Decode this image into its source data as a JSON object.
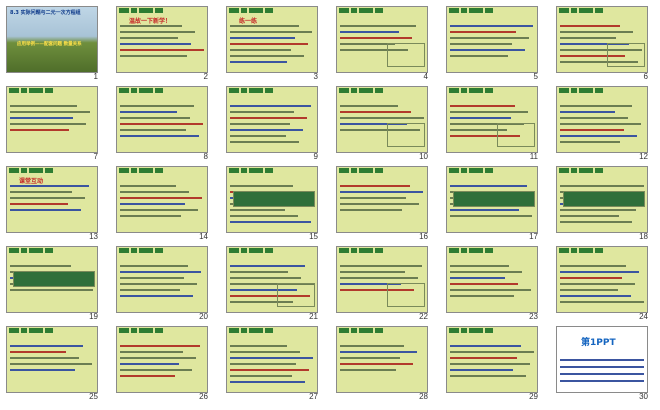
{
  "slide_sorter": {
    "slides": [
      {
        "n": "1",
        "title": "8.3 实际问题与二元一次方程组",
        "subtitle": "应用举例——配套问题 数量关系"
      },
      {
        "n": "2",
        "heading": "温故一下新学！"
      },
      {
        "n": "3",
        "heading": "练一练"
      },
      {
        "n": "4",
        "heading": ""
      },
      {
        "n": "5",
        "heading": ""
      },
      {
        "n": "6",
        "heading": ""
      },
      {
        "n": "7",
        "heading": ""
      },
      {
        "n": "8",
        "heading": ""
      },
      {
        "n": "9",
        "heading": ""
      },
      {
        "n": "10",
        "heading": ""
      },
      {
        "n": "11",
        "heading": ""
      },
      {
        "n": "12",
        "heading": ""
      },
      {
        "n": "13",
        "heading": "课堂互动"
      },
      {
        "n": "14",
        "heading": ""
      },
      {
        "n": "15",
        "heading": ""
      },
      {
        "n": "16",
        "heading": ""
      },
      {
        "n": "17",
        "heading": ""
      },
      {
        "n": "18",
        "heading": ""
      },
      {
        "n": "19",
        "heading": ""
      },
      {
        "n": "20",
        "heading": ""
      },
      {
        "n": "21",
        "heading": ""
      },
      {
        "n": "22",
        "heading": ""
      },
      {
        "n": "23",
        "heading": ""
      },
      {
        "n": "24",
        "heading": ""
      },
      {
        "n": "25",
        "heading": ""
      },
      {
        "n": "26",
        "heading": ""
      },
      {
        "n": "27",
        "heading": ""
      },
      {
        "n": "28",
        "heading": ""
      },
      {
        "n": "29",
        "heading": ""
      },
      {
        "n": "30",
        "heading": "第1PPT"
      }
    ]
  }
}
